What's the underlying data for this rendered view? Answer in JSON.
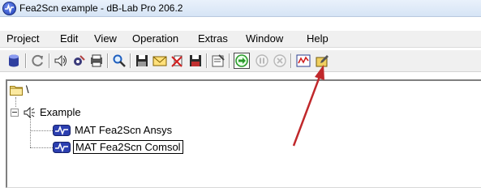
{
  "window": {
    "title": "Fea2Scn example - dB-Lab Pro 206.2"
  },
  "menu": [
    "Project",
    "Edit",
    "View",
    "Operation",
    "Extras",
    "Window",
    "Help"
  ],
  "toolbar": {
    "icons": [
      "database-icon",
      "refresh-icon",
      "speaker-icon",
      "tools-icon",
      "print-preview-icon",
      "search-icon",
      "save-icon",
      "mail-icon",
      "delete-icon",
      "save-all-icon",
      "properties-icon",
      "run-icon",
      "pause-icon",
      "stop-icon",
      "chart-icon",
      "edit-icon"
    ]
  },
  "tree": {
    "root_label": "\\",
    "project_label": "Example",
    "children": [
      "MAT Fea2Scn Ansys",
      "MAT Fea2Scn Comsol"
    ],
    "selected_index": 1
  },
  "colors": {
    "annotation_arrow": "#c0282b",
    "run_button": "#2a9a2a"
  }
}
